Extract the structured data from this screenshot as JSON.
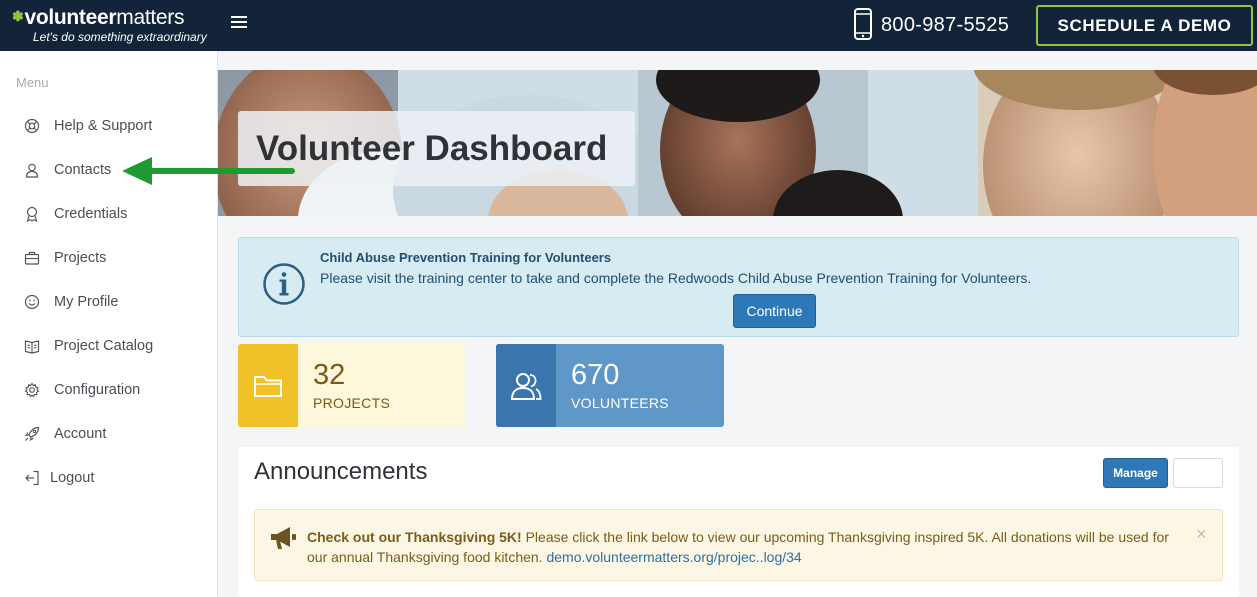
{
  "header": {
    "logo_bold": "volunteer",
    "logo_light": "matters",
    "logo_tagline": "Let's do something extraordinary",
    "phone": "800-987-5525",
    "demo_label": "SCHEDULE A DEMO"
  },
  "sidebar": {
    "heading": "Menu",
    "items": [
      {
        "label": "Help & Support",
        "icon": "life-ring-icon"
      },
      {
        "label": "Contacts",
        "icon": "contacts-icon"
      },
      {
        "label": "Credentials",
        "icon": "credentials-icon"
      },
      {
        "label": "Projects",
        "icon": "briefcase-icon"
      },
      {
        "label": "My Profile",
        "icon": "smiley-icon"
      },
      {
        "label": "Project Catalog",
        "icon": "catalog-book-icon"
      },
      {
        "label": "Configuration",
        "icon": "gear-icon"
      },
      {
        "label": "Account",
        "icon": "rocket-icon"
      },
      {
        "label": "Logout",
        "icon": "logout-icon"
      }
    ]
  },
  "hero": {
    "title": "Volunteer Dashboard"
  },
  "alert": {
    "title": "Child Abuse Prevention Training for Volunteers",
    "text": "Please visit the training center to take and complete the Redwoods Child Abuse Prevention Training for Volunteers.",
    "button": "Continue"
  },
  "stats": {
    "projects": {
      "value": "32",
      "label": "PROJECTS"
    },
    "volunteers": {
      "value": "670",
      "label": "VOLUNTEERS"
    }
  },
  "announcements": {
    "title": "Announcements",
    "manage_label": "Manage",
    "item": {
      "headline": "Check out our Thanksgiving 5K!",
      "body": " Please click the link below to view our upcoming Thanksgiving inspired 5K. All donations will be used for our annual Thanksgiving food kitchen. ",
      "link": "demo.volunteermatters.org/projec..log/34",
      "close": "×"
    }
  },
  "colors": {
    "topbar": "#13243a",
    "accent_green": "#8dc63f",
    "primary_blue": "#2f78b7",
    "projects_yellow": "#f0c227",
    "arrow_green": "#1f9a32"
  }
}
